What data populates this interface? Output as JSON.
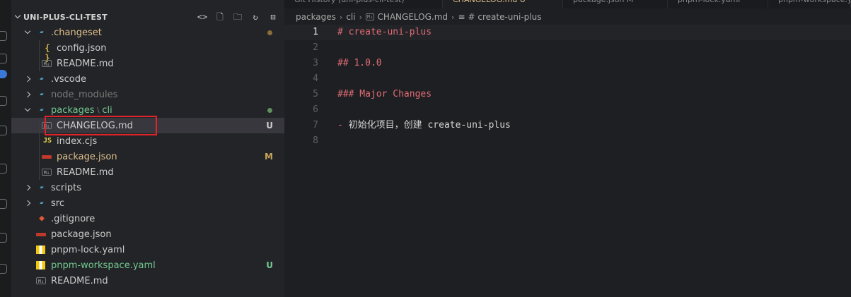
{
  "sidebar": {
    "title": "UNI-PLUS-CLI-TEST",
    "actions": [
      "new-file",
      "new-folder",
      "refresh",
      "collapse-all"
    ],
    "items": [
      {
        "label": "changeset",
        "prefix": ".",
        "kind": "folder-open",
        "color": "#e2c08d",
        "depth": 1,
        "decoration": "dot",
        "deco_color": "#8a6d3b"
      },
      {
        "label": "config.json",
        "kind": "json",
        "color": "#cccccc",
        "depth": 2
      },
      {
        "label": "README.md",
        "kind": "md",
        "color": "#cccccc",
        "depth": 2
      },
      {
        "label": ".vscode",
        "kind": "folder",
        "color": "#cccccc",
        "depth": 1
      },
      {
        "label": "node_modules",
        "kind": "folder",
        "color": "#7a7a7a",
        "depth": 1
      },
      {
        "label": "packages",
        "label2": "cli",
        "kind": "folder-open",
        "color": "#73c991",
        "depth": 1,
        "decoration": "dot",
        "deco_color": "#5f8f5f"
      },
      {
        "label": "CHANGELOG.md",
        "kind": "md",
        "color": "#cccccc",
        "depth": 2,
        "decoration": "U",
        "deco_color": "#cccccc",
        "selected": true
      },
      {
        "label": "index.cjs",
        "kind": "js",
        "color": "#cccccc",
        "depth": 2
      },
      {
        "label": "package.json",
        "kind": "pkg",
        "color": "#e2c08d",
        "depth": 2,
        "decoration": "M",
        "deco_color": "#c9a45c"
      },
      {
        "label": "README.md",
        "kind": "md",
        "color": "#cccccc",
        "depth": 2
      },
      {
        "label": "scripts",
        "kind": "folder",
        "color": "#cccccc",
        "depth": 1
      },
      {
        "label": "src",
        "kind": "folder",
        "color": "#cccccc",
        "depth": 1
      },
      {
        "label": ".gitignore",
        "kind": "git",
        "color": "#cccccc",
        "depth": 1
      },
      {
        "label": "package.json",
        "kind": "pkg",
        "color": "#cccccc",
        "depth": 1
      },
      {
        "label": "pnpm-lock.yaml",
        "kind": "yaml",
        "color": "#cccccc",
        "depth": 1
      },
      {
        "label": "pnpm-workspace.yaml",
        "kind": "yaml",
        "color": "#73c991",
        "depth": 1,
        "decoration": "U",
        "deco_color": "#73c991"
      },
      {
        "label": "README.md",
        "kind": "md",
        "color": "#cccccc",
        "depth": 1
      }
    ],
    "packages_sep": "\\",
    "changeset_prefix": "."
  },
  "tabs": [
    {
      "label": "Git History (uni-plus-cli-test)",
      "active": false
    },
    {
      "label": "CHANGELOG.md U",
      "active": true
    },
    {
      "label": "package.json M",
      "active": false
    },
    {
      "label": "pnpm-lock.yaml",
      "active": false
    },
    {
      "label": "pnpm-workspace.yaml U",
      "active": false
    }
  ],
  "breadcrumb": {
    "items": [
      "packages",
      "cli",
      "CHANGELOG.md",
      "# create-uni-plus"
    ],
    "md_badge": "M↓"
  },
  "editor": {
    "current_line": 1,
    "lines": [
      {
        "n": "1",
        "text": "# create-uni-plus",
        "type": "heading"
      },
      {
        "n": "2",
        "text": "",
        "type": "blank"
      },
      {
        "n": "3",
        "text": "## 1.0.0",
        "type": "heading"
      },
      {
        "n": "4",
        "text": "",
        "type": "blank"
      },
      {
        "n": "5",
        "text": "### Major Changes",
        "type": "heading"
      },
      {
        "n": "6",
        "text": "",
        "type": "blank"
      },
      {
        "n": "7",
        "text": "- 初始化项目，创建 create-uni-plus",
        "type": "bullet",
        "marker": "-",
        "rest": " 初始化项目，创建 create-uni-plus"
      },
      {
        "n": "8",
        "text": "",
        "type": "blank"
      }
    ]
  },
  "colors": {
    "heading": "#e06c75",
    "selected_row": "#37373d",
    "highlight_box": "#e2232a"
  }
}
